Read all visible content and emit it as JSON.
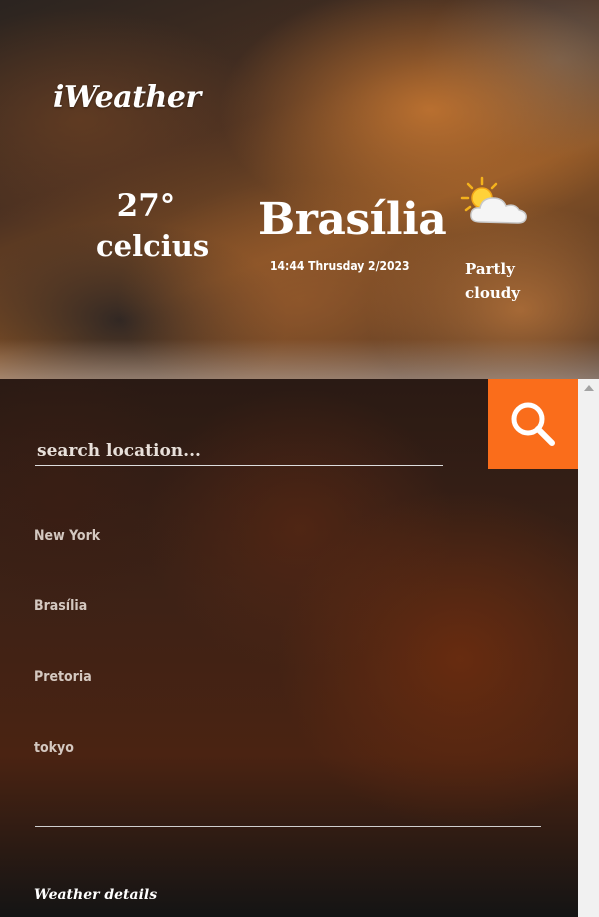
{
  "app": {
    "title": "iWeather"
  },
  "current": {
    "temperature": "27°",
    "unit": "celcius",
    "city": "Brasília",
    "datetime": "14:44 Thrusday 2/2023",
    "condition": "Partly cloudy",
    "icon": "partly-cloudy-icon"
  },
  "search": {
    "placeholder": "search location...",
    "value": "",
    "button_icon": "search-icon"
  },
  "locations": [
    "New York",
    "Brasília",
    "Pretoria",
    "tokyo"
  ],
  "details": {
    "heading": "Weather details"
  },
  "colors": {
    "accent": "#fa6d1b"
  }
}
